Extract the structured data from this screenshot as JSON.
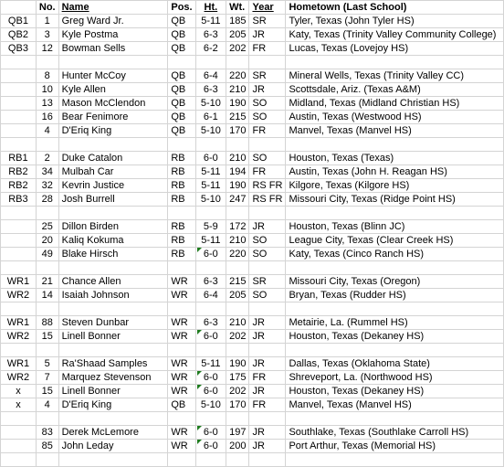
{
  "columns": {
    "depth": "",
    "no": "No.",
    "name": "Name",
    "pos": "Pos.",
    "ht": "Ht.",
    "wt": "Wt.",
    "year": "Year",
    "hometown": "Hometown (Last School)"
  },
  "rows": [
    {
      "depth": "QB1",
      "no": "1",
      "name": "Greg Ward Jr.",
      "pos": "QB",
      "ht": "5-11",
      "wt": "185",
      "year": "SR",
      "hometown": "Tyler, Texas (John Tyler HS)",
      "flag": false
    },
    {
      "depth": "QB2",
      "no": "3",
      "name": "Kyle Postma",
      "pos": "QB",
      "ht": "6-3",
      "wt": "205",
      "year": "JR",
      "hometown": "Katy, Texas (Trinity Valley Community College)",
      "flag": false
    },
    {
      "depth": "QB3",
      "no": "12",
      "name": "Bowman Sells",
      "pos": "QB",
      "ht": "6-2",
      "wt": "202",
      "year": "FR",
      "hometown": "Lucas, Texas (Lovejoy HS)",
      "flag": false
    },
    {
      "blank": true
    },
    {
      "depth": "",
      "no": "8",
      "name": "Hunter McCoy",
      "pos": "QB",
      "ht": "6-4",
      "wt": "220",
      "year": "SR",
      "hometown": "Mineral Wells, Texas (Trinity Valley CC)",
      "flag": false
    },
    {
      "depth": "",
      "no": "10",
      "name": "Kyle Allen",
      "pos": "QB",
      "ht": "6-3",
      "wt": "210",
      "year": "JR",
      "hometown": "Scottsdale, Ariz. (Texas A&M)",
      "flag": false
    },
    {
      "depth": "",
      "no": "13",
      "name": "Mason McClendon",
      "pos": "QB",
      "ht": "5-10",
      "wt": "190",
      "year": "SO",
      "hometown": "Midland, Texas (Midland Christian HS)",
      "flag": false
    },
    {
      "depth": "",
      "no": "16",
      "name": "Bear Fenimore",
      "pos": "QB",
      "ht": "6-1",
      "wt": "215",
      "year": "SO",
      "hometown": "Austin, Texas (Westwood HS)",
      "flag": false
    },
    {
      "depth": "",
      "no": "4",
      "name": "D'Eriq King",
      "pos": "QB",
      "ht": "5-10",
      "wt": "170",
      "year": "FR",
      "hometown": "Manvel, Texas (Manvel HS)",
      "flag": false
    },
    {
      "blank": true
    },
    {
      "depth": "RB1",
      "no": "2",
      "name": "Duke Catalon",
      "pos": "RB",
      "ht": "6-0",
      "wt": "210",
      "year": "SO",
      "hometown": "Houston, Texas (Texas)",
      "flag": false
    },
    {
      "depth": "RB2",
      "no": "34",
      "name": "Mulbah Car",
      "pos": "RB",
      "ht": "5-11",
      "wt": "194",
      "year": "FR",
      "hometown": "Austin, Texas (John H. Reagan HS)",
      "flag": false
    },
    {
      "depth": "RB2",
      "no": "32",
      "name": "Kevrin Justice",
      "pos": "RB",
      "ht": "5-11",
      "wt": "190",
      "year": "RS FR",
      "hometown": "Kilgore, Texas (Kilgore HS)",
      "flag": false
    },
    {
      "depth": "RB3",
      "no": "28",
      "name": "Josh Burrell",
      "pos": "RB",
      "ht": "5-10",
      "wt": "247",
      "year": "RS FR",
      "hometown": "Missouri City, Texas (Ridge Point HS)",
      "flag": false
    },
    {
      "blank": true
    },
    {
      "depth": "",
      "no": "25",
      "name": "Dillon Birden",
      "pos": "RB",
      "ht": "5-9",
      "wt": "172",
      "year": "JR",
      "hometown": "Houston, Texas (Blinn JC)",
      "flag": false
    },
    {
      "depth": "",
      "no": "20",
      "name": "Kaliq Kokuma",
      "pos": "RB",
      "ht": "5-11",
      "wt": "210",
      "year": "SO",
      "hometown": "League City, Texas (Clear Creek HS)",
      "flag": false
    },
    {
      "depth": "",
      "no": "49",
      "name": "Blake Hirsch",
      "pos": "RB",
      "ht": "6-0",
      "wt": "220",
      "year": "SO",
      "hometown": "Katy, Texas (Cinco Ranch HS)",
      "flag": true
    },
    {
      "blank": true
    },
    {
      "depth": "WR1",
      "no": "21",
      "name": "Chance Allen",
      "pos": "WR",
      "ht": "6-3",
      "wt": "215",
      "year": "SR",
      "hometown": "Missouri City, Texas (Oregon)",
      "flag": false
    },
    {
      "depth": "WR2",
      "no": "14",
      "name": "Isaiah Johnson",
      "pos": "WR",
      "ht": "6-4",
      "wt": "205",
      "year": "SO",
      "hometown": "Bryan, Texas (Rudder HS)",
      "flag": false
    },
    {
      "blank": true
    },
    {
      "depth": "WR1",
      "no": "88",
      "name": "Steven Dunbar",
      "pos": "WR",
      "ht": "6-3",
      "wt": "210",
      "year": "JR",
      "hometown": "Metairie, La. (Rummel HS)",
      "flag": false
    },
    {
      "depth": "WR2",
      "no": "15",
      "name": "Linell Bonner",
      "pos": "WR",
      "ht": "6-0",
      "wt": "202",
      "year": "JR",
      "hometown": "Houston, Texas (Dekaney HS)",
      "flag": true
    },
    {
      "blank": true
    },
    {
      "depth": "WR1",
      "no": "5",
      "name": "Ra'Shaad Samples",
      "pos": "WR",
      "ht": "5-11",
      "wt": "190",
      "year": "JR",
      "hometown": "Dallas, Texas (Oklahoma State)",
      "flag": false
    },
    {
      "depth": "WR2",
      "no": "7",
      "name": "Marquez Stevenson",
      "pos": "WR",
      "ht": "6-0",
      "wt": "175",
      "year": "FR",
      "hometown": "Shreveport, La. (Northwood HS)",
      "flag": true
    },
    {
      "depth": "x",
      "no": "15",
      "name": "Linell Bonner",
      "pos": "WR",
      "ht": "6-0",
      "wt": "202",
      "year": "JR",
      "hometown": "Houston, Texas (Dekaney HS)",
      "flag": true
    },
    {
      "depth": "x",
      "no": "4",
      "name": "D'Eriq King",
      "pos": "QB",
      "ht": "5-10",
      "wt": "170",
      "year": "FR",
      "hometown": "Manvel, Texas (Manvel HS)",
      "flag": false
    },
    {
      "blank": true
    },
    {
      "depth": "",
      "no": "83",
      "name": "Derek McLemore",
      "pos": "WR",
      "ht": "6-0",
      "wt": "197",
      "year": "JR",
      "hometown": "Southlake, Texas (Southlake Carroll HS)",
      "flag": true
    },
    {
      "depth": "",
      "no": "85",
      "name": "John Leday",
      "pos": "WR",
      "ht": "6-0",
      "wt": "200",
      "year": "JR",
      "hometown": "Port Arthur, Texas (Memorial HS)",
      "flag": true
    },
    {
      "blank": true
    }
  ]
}
